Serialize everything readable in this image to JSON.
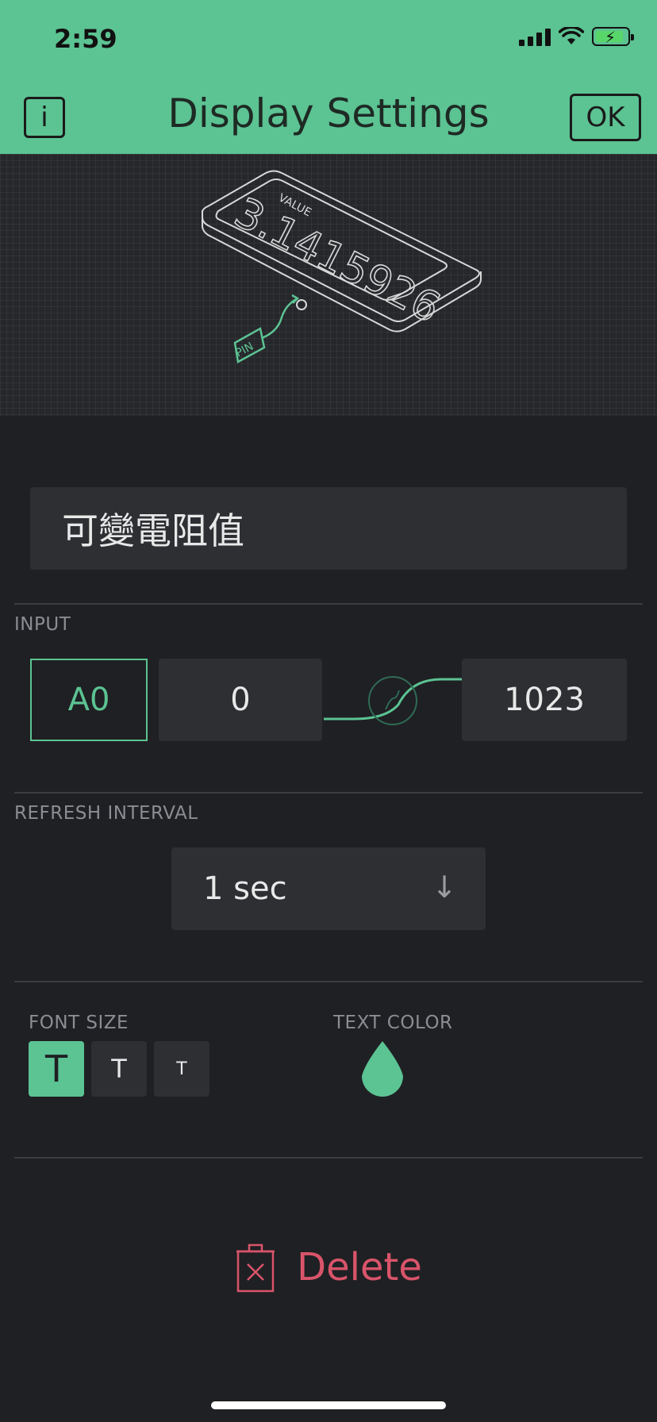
{
  "status_bar": {
    "time": "2:59"
  },
  "header": {
    "info_label": "i",
    "title": "Display Settings",
    "ok_label": "OK"
  },
  "illustration": {
    "value_caption": "VALUE",
    "value_digits": "3.1415926",
    "pin_caption": "PIN"
  },
  "widget_name": "可變電阻值",
  "input": {
    "label": "INPUT",
    "pin": "A0",
    "min": "0",
    "max": "1023"
  },
  "refresh": {
    "label": "REFRESH INTERVAL",
    "selected": "1 sec"
  },
  "font_size": {
    "label": "FONT SIZE",
    "options": [
      "T",
      "T",
      "T"
    ]
  },
  "text_color": {
    "label": "TEXT COLOR",
    "color": "#5cc393"
  },
  "delete_label": "Delete",
  "colors": {
    "accent": "#5cc393",
    "background": "#1f2023",
    "field": "#2d2f33",
    "danger": "#d9546a"
  }
}
